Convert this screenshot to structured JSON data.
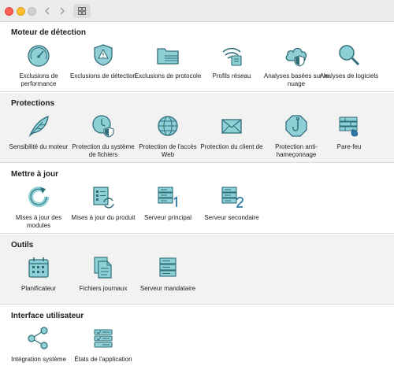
{
  "colors": {
    "icon_fill": "#8ed0d5",
    "icon_stroke": "#2f6e79",
    "accent_blue": "#2a79a8"
  },
  "toolbar": {
    "back_icon": "chevron-left-icon",
    "forward_icon": "chevron-right-icon",
    "view_icon": "grid-icon"
  },
  "sections": [
    {
      "title": "Moteur de détection",
      "items": [
        {
          "label": "Exclusions de performance",
          "icon": "gauge-icon"
        },
        {
          "label": "Exclusions de détection",
          "icon": "shield-warning-icon"
        },
        {
          "label": "Exclusions de protocole",
          "icon": "folder-lines-icon"
        },
        {
          "label": "Profils réseau",
          "icon": "wifi-device-icon"
        },
        {
          "label": "Analyses basées sur le nuage",
          "icon": "cloud-shield-icon"
        },
        {
          "label": "Analyses de logiciels",
          "icon": "magnifier-icon"
        }
      ]
    },
    {
      "title": "Protections",
      "items": [
        {
          "label": "Sensibilité du moteur",
          "icon": "feather-icon"
        },
        {
          "label": "Protection du système de fichiers",
          "icon": "clock-shield-icon"
        },
        {
          "label": "Protection de l'accès Web",
          "icon": "globe-icon"
        },
        {
          "label": "Protection du client de",
          "icon": "envelope-icon"
        },
        {
          "label": "Protection anti-hameçonnage",
          "icon": "hook-icon"
        },
        {
          "label": "Pare-feu",
          "icon": "firewall-icon"
        }
      ]
    },
    {
      "title": "Mettre à jour",
      "items": [
        {
          "label": "Mises à jour des modules",
          "icon": "refresh-icon"
        },
        {
          "label": "Mises à jour du produit",
          "icon": "product-update-icon"
        },
        {
          "label": "Serveur principal",
          "icon": "server-one-icon"
        },
        {
          "label": "Serveur secondaire",
          "icon": "server-two-icon"
        }
      ]
    },
    {
      "title": "Outils",
      "items": [
        {
          "label": "Planificateur",
          "icon": "calendar-icon"
        },
        {
          "label": "Fichiers journaux",
          "icon": "log-files-icon"
        },
        {
          "label": "Serveur mandataire",
          "icon": "proxy-server-icon"
        }
      ]
    },
    {
      "title": "Interface utilisateur",
      "items": [
        {
          "label": "Intégration système",
          "icon": "integration-nodes-icon"
        },
        {
          "label": "États de l'application",
          "icon": "app-states-icon"
        }
      ]
    }
  ]
}
